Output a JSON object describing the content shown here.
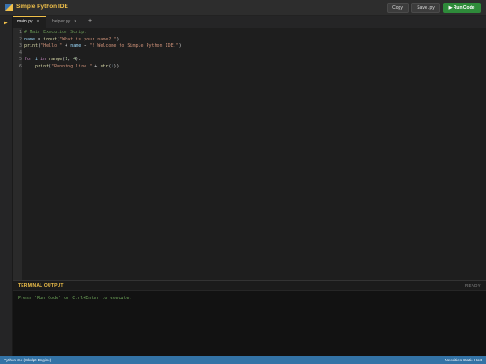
{
  "app": {
    "title": "Simple Python IDE"
  },
  "toolbar": {
    "copy_label": "Copy",
    "save_label": "Save .py",
    "run_label": "▶ Run Code"
  },
  "tabs": [
    {
      "label": "main.py",
      "close": "×",
      "active": true
    },
    {
      "label": "helper.py",
      "close": "×",
      "active": false
    }
  ],
  "add_tab_label": "+",
  "editor": {
    "lines": [
      {
        "n": "1",
        "tokens": [
          {
            "t": "# Main Execution Script",
            "c": "comment"
          }
        ]
      },
      {
        "n": "2",
        "tokens": [
          {
            "t": "name",
            "c": "var"
          },
          {
            "t": " = ",
            "c": "op"
          },
          {
            "t": "input",
            "c": "func"
          },
          {
            "t": "(",
            "c": "op"
          },
          {
            "t": "\"What is your name? \"",
            "c": "str"
          },
          {
            "t": ")",
            "c": "op"
          }
        ]
      },
      {
        "n": "3",
        "tokens": [
          {
            "t": "print",
            "c": "func"
          },
          {
            "t": "(",
            "c": "op"
          },
          {
            "t": "\"Hello \"",
            "c": "str"
          },
          {
            "t": " + ",
            "c": "op"
          },
          {
            "t": "name",
            "c": "var"
          },
          {
            "t": " + ",
            "c": "op"
          },
          {
            "t": "\"! Welcome to Simple Python IDE.\"",
            "c": "str"
          },
          {
            "t": ")",
            "c": "op"
          }
        ]
      },
      {
        "n": "4",
        "tokens": []
      },
      {
        "n": "5",
        "tokens": [
          {
            "t": "for",
            "c": "kw"
          },
          {
            "t": " i ",
            "c": "var"
          },
          {
            "t": "in",
            "c": "kw"
          },
          {
            "t": " ",
            "c": "op"
          },
          {
            "t": "range",
            "c": "func"
          },
          {
            "t": "(",
            "c": "op"
          },
          {
            "t": "1",
            "c": "num"
          },
          {
            "t": ", ",
            "c": "op"
          },
          {
            "t": "4",
            "c": "num"
          },
          {
            "t": "):",
            "c": "op"
          }
        ]
      },
      {
        "n": "6",
        "tokens": [
          {
            "t": "    ",
            "c": "op"
          },
          {
            "t": "print",
            "c": "func"
          },
          {
            "t": "(",
            "c": "op"
          },
          {
            "t": "\"Running line \"",
            "c": "str"
          },
          {
            "t": " + ",
            "c": "op"
          },
          {
            "t": "str",
            "c": "func"
          },
          {
            "t": "(",
            "c": "op"
          },
          {
            "t": "i",
            "c": "var"
          },
          {
            "t": "))",
            "c": "op"
          }
        ]
      }
    ]
  },
  "terminal": {
    "title": "TERMINAL OUTPUT",
    "status": "READY",
    "output": "Press 'Run Code' or Ctrl+Enter to execute."
  },
  "statusbar": {
    "left": "Python 3.x (Skulpt Engine)",
    "right": "Neocities Static Host"
  },
  "colors": {
    "accent": "#f0c04a",
    "run": "#2e8b3a",
    "statusbar": "#3373a6"
  }
}
